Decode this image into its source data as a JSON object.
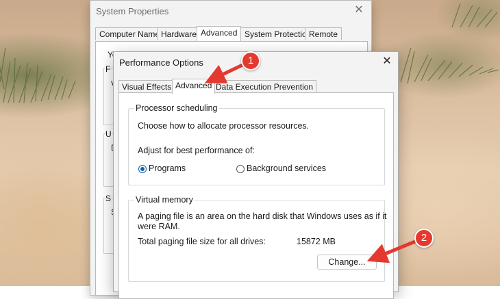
{
  "system_properties": {
    "title": "System Properties",
    "close_glyph": "✕",
    "tabs": [
      {
        "label": "Computer Name"
      },
      {
        "label": "Hardware"
      },
      {
        "label": "Advanced",
        "active": true
      },
      {
        "label": "System Protection"
      },
      {
        "label": "Remote"
      }
    ],
    "peek_text": {
      "line1": "Yo",
      "line2": "F",
      "line3": "V",
      "line4": "U",
      "line5": "D",
      "line6": "S",
      "line7": "S"
    }
  },
  "performance_options": {
    "title": "Performance Options",
    "close_glyph": "✕",
    "tabs": [
      {
        "label": "Visual Effects"
      },
      {
        "label": "Advanced",
        "active": true
      },
      {
        "label": "Data Execution Prevention"
      }
    ],
    "processor_scheduling": {
      "legend": "Processor scheduling",
      "description": "Choose how to allocate processor resources.",
      "adjust_label": "Adjust for best performance of:",
      "options": [
        {
          "label": "Programs",
          "checked": true
        },
        {
          "label": "Background services",
          "checked": false
        }
      ]
    },
    "virtual_memory": {
      "legend": "Virtual memory",
      "description_line1": "A paging file is an area on the hard disk that Windows uses as if it",
      "description_line2": "were RAM.",
      "total_label": "Total paging file size for all drives:",
      "total_value": "15872 MB",
      "change_button": "Change..."
    }
  },
  "callouts": [
    {
      "number": "1"
    },
    {
      "number": "2"
    }
  ],
  "colors": {
    "callout": "#e4392f",
    "radio_accent": "#0f5fb5"
  }
}
